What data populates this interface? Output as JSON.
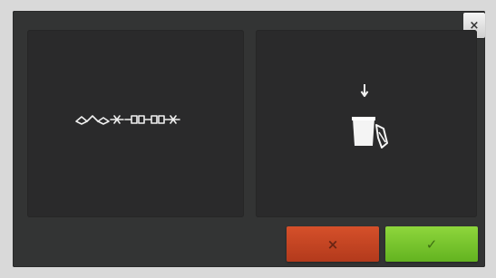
{
  "dialog": {
    "close_label": "×",
    "left_panel": {
      "icon": "stitch-pattern-icon"
    },
    "right_panel": {
      "arrow_icon": "down-arrow-icon",
      "bobbin_icon": "bobbin-case-icon"
    },
    "buttons": {
      "cancel_label": "×",
      "ok_label": "✓"
    }
  },
  "colors": {
    "dialog_bg": "#333434",
    "panel_bg": "#2a2a2b",
    "cancel": "#c4442a",
    "ok": "#7cc62e"
  }
}
